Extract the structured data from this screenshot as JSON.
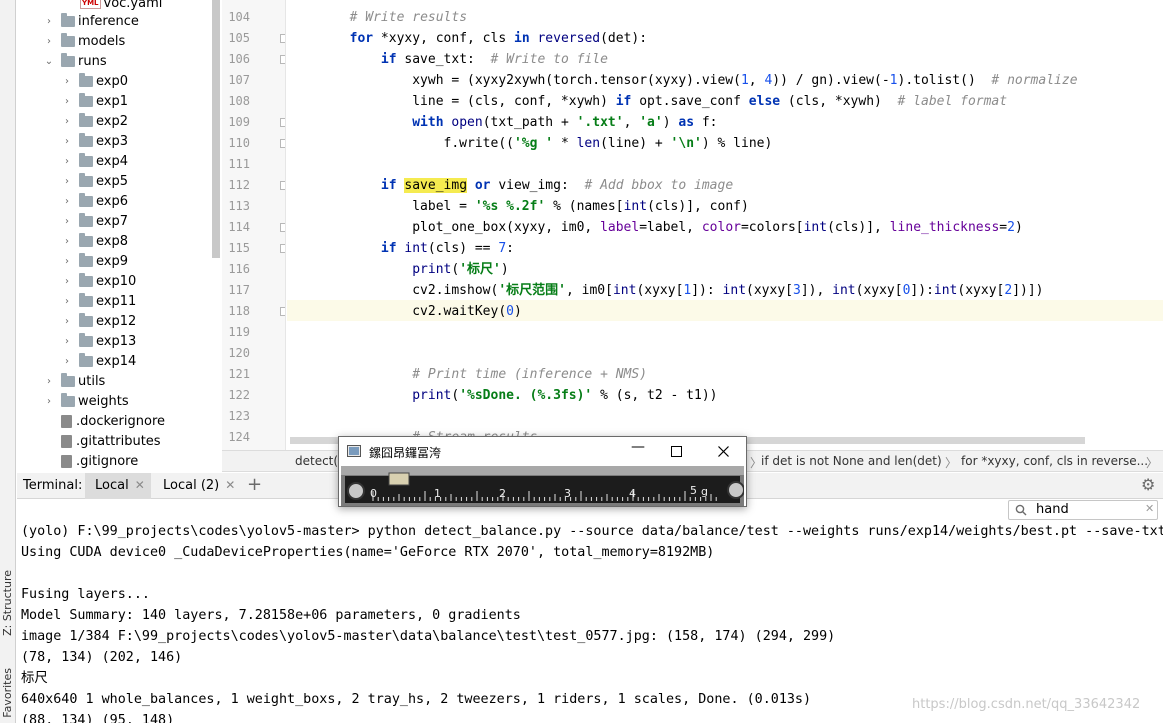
{
  "tool_strip": {
    "structure_label": "Z: Structure",
    "favorites_label": "Favorites"
  },
  "tree": {
    "items": [
      {
        "label": "voc.yaml",
        "kind": "yaml"
      },
      {
        "label": "inference",
        "kind": "folder"
      },
      {
        "label": "models",
        "kind": "folder"
      },
      {
        "label": "runs",
        "kind": "folder-open"
      },
      {
        "label": "exp0",
        "kind": "folder"
      },
      {
        "label": "exp1",
        "kind": "folder"
      },
      {
        "label": "exp2",
        "kind": "folder"
      },
      {
        "label": "exp3",
        "kind": "folder"
      },
      {
        "label": "exp4",
        "kind": "folder"
      },
      {
        "label": "exp5",
        "kind": "folder"
      },
      {
        "label": "exp6",
        "kind": "folder"
      },
      {
        "label": "exp7",
        "kind": "folder"
      },
      {
        "label": "exp8",
        "kind": "folder"
      },
      {
        "label": "exp9",
        "kind": "folder"
      },
      {
        "label": "exp10",
        "kind": "folder"
      },
      {
        "label": "exp11",
        "kind": "folder"
      },
      {
        "label": "exp12",
        "kind": "folder"
      },
      {
        "label": "exp13",
        "kind": "folder"
      },
      {
        "label": "exp14",
        "kind": "folder"
      },
      {
        "label": "utils",
        "kind": "folder"
      },
      {
        "label": "weights",
        "kind": "folder"
      },
      {
        "label": ".dockerignore",
        "kind": "file"
      },
      {
        "label": ".gitattributes",
        "kind": "file"
      },
      {
        "label": ".gitignore",
        "kind": "file"
      }
    ]
  },
  "editor": {
    "current_line": "118",
    "lines": [
      {
        "num": "104",
        "html": "        <span class=\"cm\"># Write results</span>"
      },
      {
        "num": "105",
        "html": "        <span class=\"kw\">for</span> *xyxy, conf, cls <span class=\"kw\">in</span> <span class=\"bi\">reversed</span>(det):"
      },
      {
        "num": "106",
        "html": "            <span class=\"kw\">if</span> save_txt:  <span class=\"cm\"># Write to file</span>"
      },
      {
        "num": "107",
        "html": "                xywh = (xyxy2xywh(torch.tensor(xyxy).view(<span class=\"nu\">1</span>, <span class=\"nu\">4</span>)) / gn).view(-<span class=\"nu\">1</span>).tolist()  <span class=\"cm\"># normalize</span>"
      },
      {
        "num": "108",
        "html": "                line = (cls, conf, *xywh) <span class=\"kw\">if</span> opt.save_conf <span class=\"kw\">else</span> (cls, *xywh)  <span class=\"cm\"># label format</span>"
      },
      {
        "num": "109",
        "html": "                <span class=\"kw\">with</span> <span class=\"bi\">open</span>(txt_path + <span class=\"st\">'.txt'</span>, <span class=\"st\">'a'</span>) <span class=\"kw\">as</span> f:"
      },
      {
        "num": "110",
        "html": "                    f.write((<span class=\"st\">'%g '</span> * <span class=\"bi\">len</span>(line) + <span class=\"st\">'\\n'</span>) % line)"
      },
      {
        "num": "111",
        "html": ""
      },
      {
        "num": "112",
        "html": "            <span class=\"kw\">if</span> <span class=\"hl\">save_img</span> <span class=\"kw\">or</span> view_img:  <span class=\"cm\"># Add bbox to image</span>"
      },
      {
        "num": "113",
        "html": "                label = <span class=\"st\">'%s %.2f'</span> % (names[<span class=\"bi\">int</span>(cls)], conf)"
      },
      {
        "num": "114",
        "html": "                plot_one_box(xyxy, im0, <span class=\"pa\">label</span>=label, <span class=\"pa\">color</span>=colors[<span class=\"bi\">int</span>(cls)], <span class=\"pa\">line_thickness</span>=<span class=\"nu\">2</span>)"
      },
      {
        "num": "115",
        "html": "            <span class=\"kw\">if</span> <span class=\"bi\">int</span>(cls) == <span class=\"nu\">7</span>:"
      },
      {
        "num": "116",
        "html": "                <span class=\"bi\">print</span>(<span class=\"st\">'标尺'</span>)"
      },
      {
        "num": "117",
        "html": "                cv2.imshow(<span class=\"st\">'标尺范围'</span>, im0[<span class=\"bi\">int</span>(xyxy[<span class=\"nu\">1</span>]): <span class=\"bi\">int</span>(xyxy[<span class=\"nu\">3</span>]), <span class=\"bi\">int</span>(xyxy[<span class=\"nu\">0</span>]):<span class=\"bi\">int</span>(xyxy[<span class=\"nu\">2</span>])])"
      },
      {
        "num": "118",
        "html": "                cv2.waitKey(<span class=\"nu\">0</span>)"
      },
      {
        "num": "119",
        "html": ""
      },
      {
        "num": "120",
        "html": ""
      },
      {
        "num": "121",
        "html": "                <span class=\"cm\"># Print time (inference + NMS)</span>"
      },
      {
        "num": "122",
        "html": "                <span class=\"bi\">print</span>(<span class=\"st\">'%sDone. (%.3fs)'</span> % (s, t2 - t1))"
      },
      {
        "num": "123",
        "html": ""
      },
      {
        "num": "124",
        "html": "                <span class=\"cm\"># Stream results</span>"
      }
    ]
  },
  "breadcrumb": {
    "items": [
      "detect()",
      "if det is not None and len(det)",
      "for *xyxy, conf, cls in reverse..."
    ]
  },
  "terminal": {
    "label": "Terminal:",
    "tabs": [
      {
        "label": "Local"
      },
      {
        "label": "Local (2)"
      }
    ],
    "add_label": "+",
    "search_value": "hand",
    "lines": [
      "(yolo) F:\\99_projects\\codes\\yolov5-master> python detect_balance.py --source data/balance/test --weights runs/exp14/weights/best.pt --save-txt",
      "Using CUDA device0 _CudaDeviceProperties(name='GeForce RTX 2070', total_memory=8192MB)",
      "",
      "Fusing layers...",
      "Model Summary: 140 layers, 7.28158e+06 parameters, 0 gradients",
      "image 1/384 F:\\99_projects\\codes\\yolov5-master\\data\\balance\\test\\test_0577.jpg: (158, 174) (294, 299)",
      "(78, 134) (202, 146)",
      "标尺",
      "640x640 1 whole_balances, 1 weight_boxs, 2 tray_hs, 2 tweezers, 1 riders, 1 scales, Done. (0.013s)",
      "(88, 134) (95, 148)"
    ]
  },
  "popup": {
    "title": "鏍囧昂鑼冨洿",
    "scale_digits": [
      "0",
      "1",
      "2",
      "3",
      "4",
      "5"
    ],
    "scale_unit": "g"
  },
  "watermark": "https://blog.csdn.net/qq_33642342"
}
